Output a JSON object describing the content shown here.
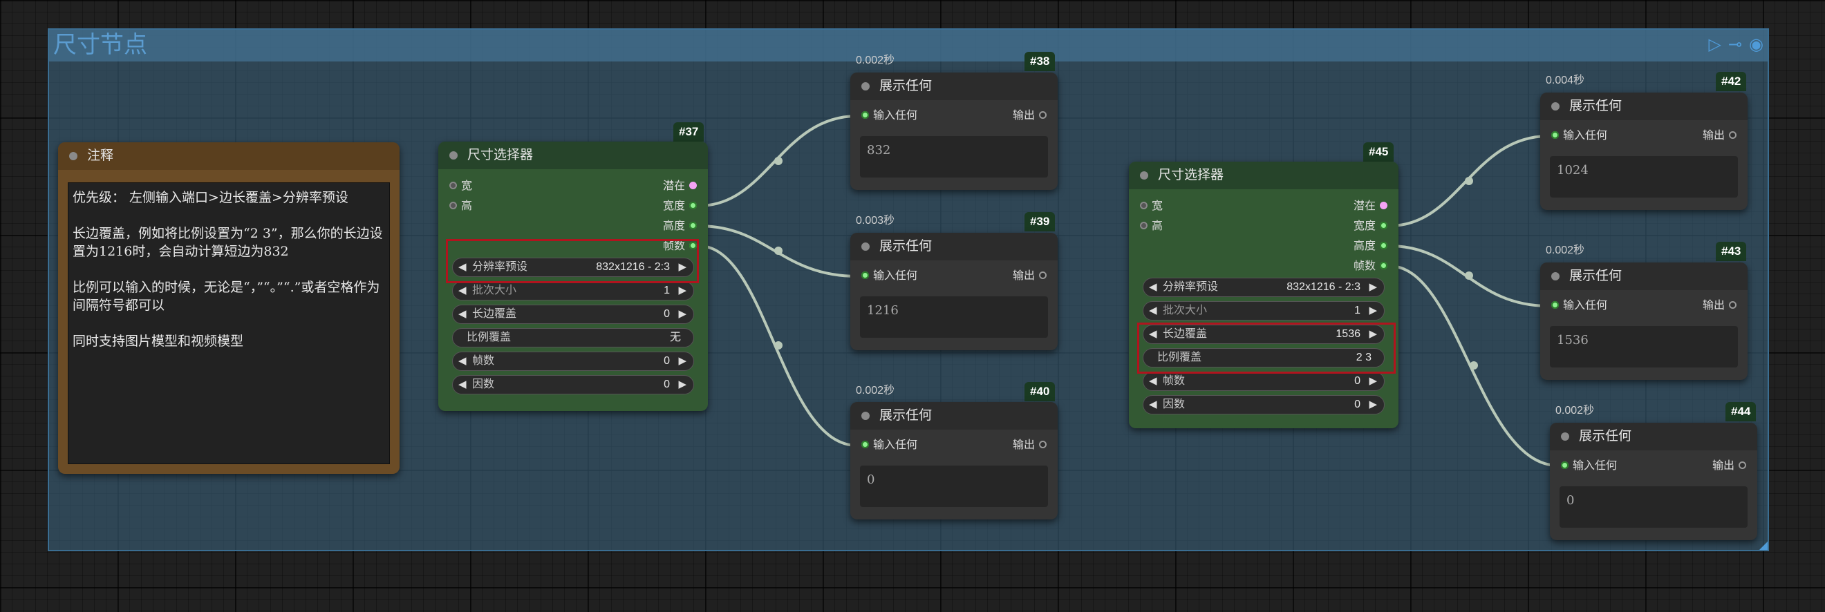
{
  "group": {
    "title": "尺寸节点",
    "icons": [
      "play-icon",
      "connect-icon",
      "eye-icon"
    ]
  },
  "note": {
    "title": "注释",
    "text": "优先级： 左侧输入端口>边长覆盖>分辨率预设\n\n长边覆盖，例如将比例设置为“2 3”，那么你的长边设置为1216时，会自动计算短边为832\n\n比例可以输入的时候，无论是“，”“。”“.”或者空格作为间隔符号都可以\n\n同时支持图片模型和视频模型"
  },
  "selector37": {
    "id": "#37",
    "title": "尺寸选择器",
    "inputs": [
      "宽",
      "高"
    ],
    "outputs": [
      "潜在",
      "宽度",
      "高度",
      "帧数"
    ],
    "widgets": [
      {
        "label": "分辨率预设",
        "value": "832x1216 - 2:3"
      },
      {
        "label": "批次大小",
        "value": "1"
      },
      {
        "label": "长边覆盖",
        "value": "0"
      },
      {
        "label": "比例覆盖",
        "value": "无"
      },
      {
        "label": "帧数",
        "value": "0"
      },
      {
        "label": "因数",
        "value": "0"
      }
    ]
  },
  "selector45": {
    "id": "#45",
    "title": "尺寸选择器",
    "inputs": [
      "宽",
      "高"
    ],
    "outputs": [
      "潜在",
      "宽度",
      "高度",
      "帧数"
    ],
    "widgets": [
      {
        "label": "分辨率预设",
        "value": "832x1216 - 2:3"
      },
      {
        "label": "批次大小",
        "value": "1"
      },
      {
        "label": "长边覆盖",
        "value": "1536"
      },
      {
        "label": "比例覆盖",
        "value": "2 3"
      },
      {
        "label": "帧数",
        "value": "0"
      },
      {
        "label": "因数",
        "value": "0"
      }
    ]
  },
  "show_nodes": [
    {
      "id": "#38",
      "time": "0.002秒",
      "title": "展示任何",
      "input": "输入任何",
      "output": "输出",
      "value": "832"
    },
    {
      "id": "#39",
      "time": "0.003秒",
      "title": "展示任何",
      "input": "输入任何",
      "output": "输出",
      "value": "1216"
    },
    {
      "id": "#40",
      "time": "0.002秒",
      "title": "展示任何",
      "input": "输入任何",
      "output": "输出",
      "value": "0"
    },
    {
      "id": "#42",
      "time": "0.004秒",
      "title": "展示任何",
      "input": "输入任何",
      "output": "输出",
      "value": "1024"
    },
    {
      "id": "#43",
      "time": "0.002秒",
      "title": "展示任何",
      "input": "输入任何",
      "output": "输出",
      "value": "1536"
    },
    {
      "id": "#44",
      "time": "0.002秒",
      "title": "展示任何",
      "input": "输入任何",
      "output": "输出",
      "value": "0"
    }
  ],
  "colors": {
    "group": "#395d76",
    "node_green": "#335933",
    "node_note": "#6b4c26",
    "highlight": "#b0141e",
    "wire": "#b8c8b8"
  }
}
